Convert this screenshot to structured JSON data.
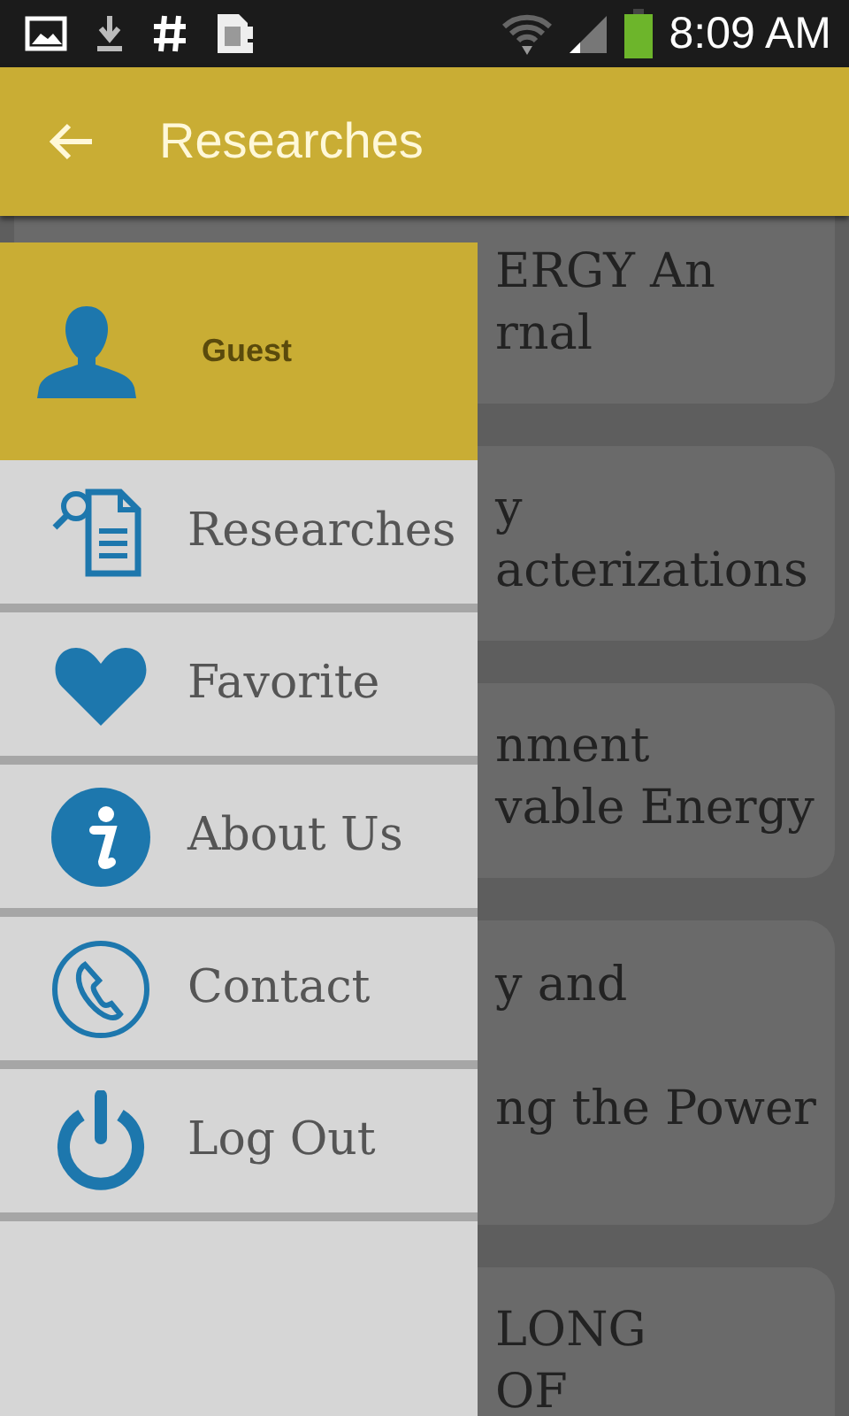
{
  "status_bar": {
    "time": "8:09 AM"
  },
  "app_bar": {
    "title": "Researches"
  },
  "background_cards": [
    {
      "kind": "normal",
      "lines": [
        "ERGY An",
        "rnal"
      ]
    },
    {
      "kind": "normal",
      "lines": [
        "y",
        "acterizations"
      ]
    },
    {
      "kind": "normal",
      "lines": [
        "nment",
        "vable Energy"
      ]
    },
    {
      "kind": "spaced",
      "lines": [
        "y and",
        "ng the Power"
      ]
    },
    {
      "kind": "normal",
      "lines": [
        "LONG",
        "OF"
      ]
    }
  ],
  "drawer": {
    "user": {
      "name": "Guest"
    },
    "items": [
      {
        "label": "Researches",
        "kind": "researches"
      },
      {
        "label": "Favorite",
        "kind": "favorite"
      },
      {
        "label": "About Us",
        "kind": "about"
      },
      {
        "label": "Contact",
        "kind": "contact"
      },
      {
        "label": "Log Out",
        "kind": "logout"
      }
    ]
  }
}
